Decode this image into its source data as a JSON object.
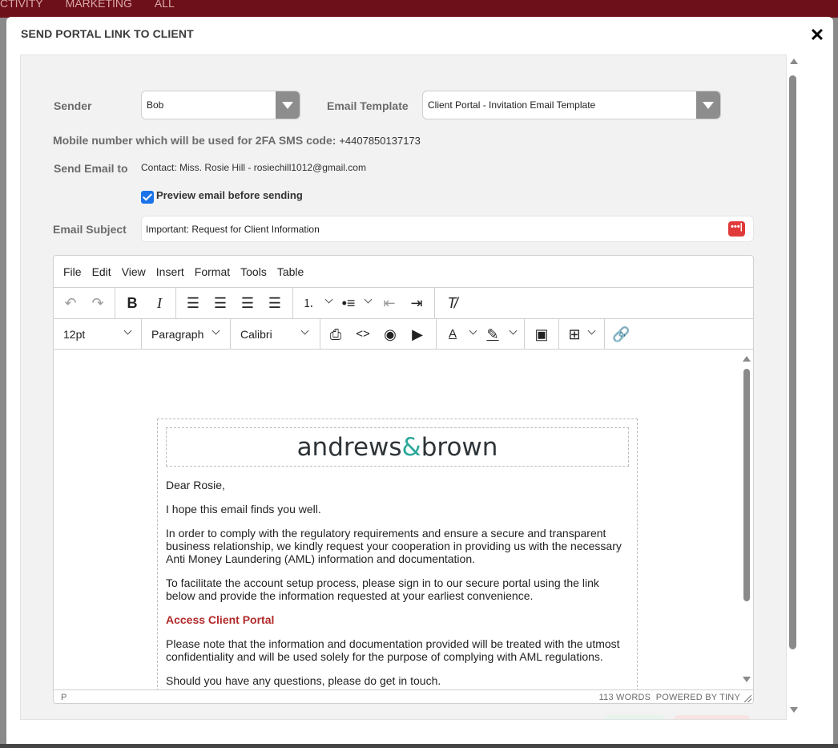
{
  "background_nav": {
    "items": [
      "CTIVITY",
      "MARKETING",
      "ALL"
    ]
  },
  "modal": {
    "title": "SEND PORTAL LINK TO CLIENT",
    "close_glyph": "✕"
  },
  "form": {
    "sender_label": "Sender",
    "sender_value": "Bob",
    "template_label": "Email Template",
    "template_value": "Client Portal - Invitation Email Template",
    "mobile_label": "Mobile number which will be used for 2FA SMS code:",
    "mobile_value": "+4407850137173",
    "send_to_label": "Send Email to",
    "send_to_value": "Contact: Miss. Rosie Hill - rosiechill1012@gmail.com",
    "preview_label": "Preview email before sending",
    "preview_checked": true,
    "subject_label": "Email Subject",
    "subject_value": "Important: Request for Client Information",
    "subject_badge": "•••|"
  },
  "editor": {
    "menu": [
      "File",
      "Edit",
      "View",
      "Insert",
      "Format",
      "Tools",
      "Table"
    ],
    "font_size": "12pt",
    "block_format": "Paragraph",
    "font_family": "Calibri",
    "status_path": "P",
    "status_words": "113 WORDS",
    "status_brand": "POWERED BY TINY"
  },
  "email": {
    "logo_left": "andrews",
    "logo_amp": "&",
    "logo_right": "brown",
    "greeting": "Dear Rosie,",
    "p1": "I hope this email finds you well.",
    "p2": "In order to comply with the regulatory requirements and ensure a secure and transparent business relationship, we kindly request your cooperation in providing us with the necessary Anti Money Laundering (AML) information and documentation.",
    "p3": "To facilitate the account setup process, please sign in to our secure portal using the link below and provide the information requested at your earliest convenience.",
    "link": "Access Client Portal",
    "p4": "Please note that the information and documentation provided will be treated with the utmost confidentiality and will be used solely for the purpose of complying with AML regulations.",
    "p5": "Should you have any questions, please do get in touch."
  },
  "colors": {
    "accent_blue": "#1a73e8",
    "link_red": "#b22a2a",
    "topbar": "#6e1019",
    "logo_teal": "#2aa89a"
  }
}
